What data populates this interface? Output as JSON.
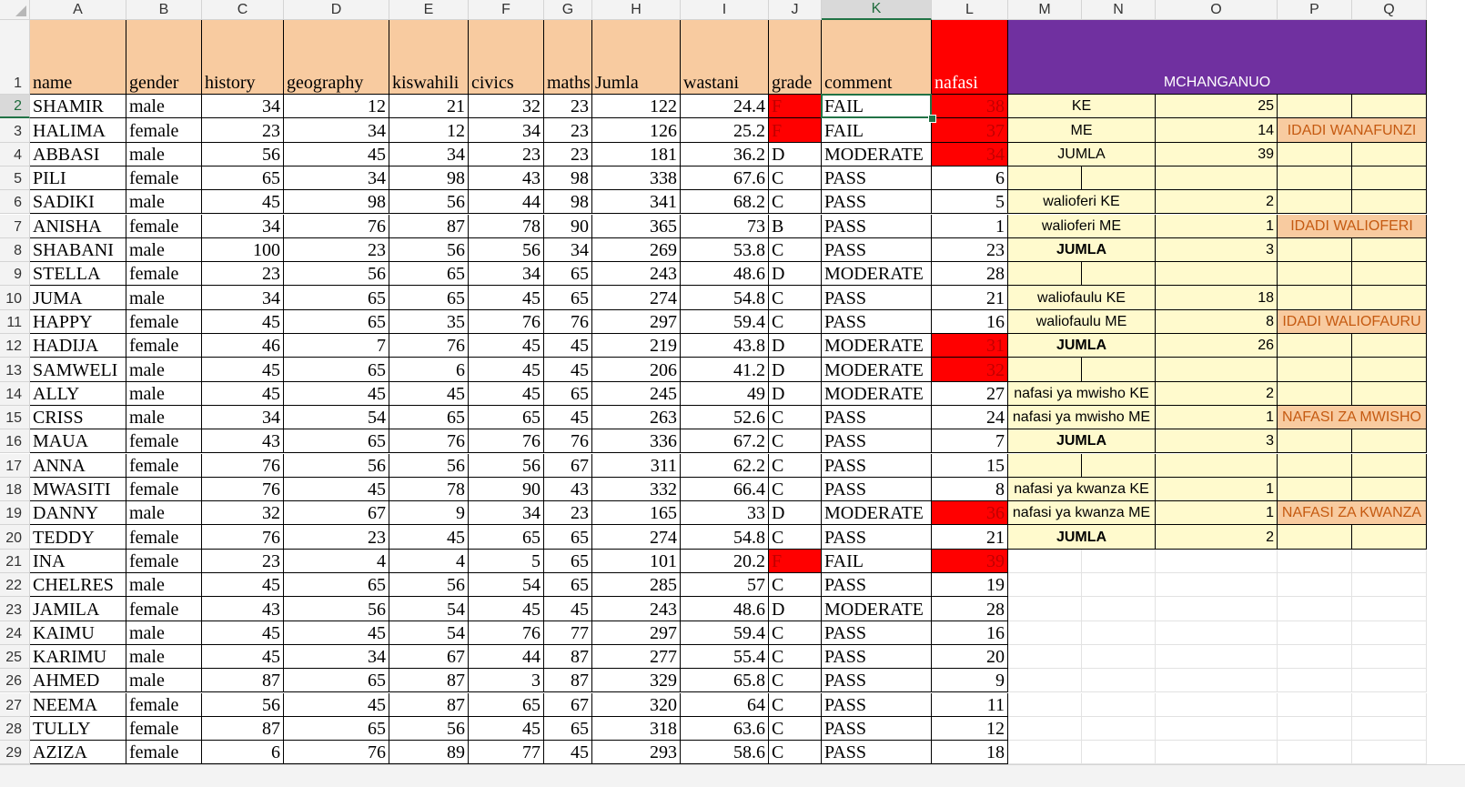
{
  "columns": [
    "A",
    "B",
    "C",
    "D",
    "E",
    "F",
    "G",
    "H",
    "I",
    "J",
    "K",
    "L",
    "M",
    "N",
    "O",
    "P",
    "Q"
  ],
  "selected_column": "K",
  "selected_row": 2,
  "headers": {
    "A": "name",
    "B": "gender",
    "C": "history",
    "D": "geography",
    "E": "kiswahili",
    "F": "civics",
    "G": "maths",
    "H": "Jumla",
    "I": "wastani",
    "J": "grade",
    "K": "comment",
    "L": "nafasi",
    "M": "MCHANGANUO"
  },
  "rows": [
    {
      "n": 2,
      "name": "SHAMIR",
      "gender": "male",
      "history": "34",
      "geography": "12",
      "kiswahili": "21",
      "civics": "32",
      "maths": "23",
      "jumla": "122",
      "wastani": "24.4",
      "grade": "F",
      "comment": "FAIL",
      "nafasi": "38"
    },
    {
      "n": 3,
      "name": "HALIMA",
      "gender": "female",
      "history": "23",
      "geography": "34",
      "kiswahili": "12",
      "civics": "34",
      "maths": "23",
      "jumla": "126",
      "wastani": "25.2",
      "grade": "F",
      "comment": "FAIL",
      "nafasi": "37"
    },
    {
      "n": 4,
      "name": "ABBASI",
      "gender": "male",
      "history": "56",
      "geography": "45",
      "kiswahili": "34",
      "civics": "23",
      "maths": "23",
      "jumla": "181",
      "wastani": "36.2",
      "grade": "D",
      "comment": "MODERATE",
      "nafasi": "34"
    },
    {
      "n": 5,
      "name": "PILI",
      "gender": "female",
      "history": "65",
      "geography": "34",
      "kiswahili": "98",
      "civics": "43",
      "maths": "98",
      "jumla": "338",
      "wastani": "67.6",
      "grade": "C",
      "comment": "PASS",
      "nafasi": "6"
    },
    {
      "n": 6,
      "name": "SADIKI",
      "gender": "male",
      "history": "45",
      "geography": "98",
      "kiswahili": "56",
      "civics": "44",
      "maths": "98",
      "jumla": "341",
      "wastani": "68.2",
      "grade": "C",
      "comment": "PASS",
      "nafasi": "5"
    },
    {
      "n": 7,
      "name": "ANISHA",
      "gender": "female",
      "history": "34",
      "geography": "76",
      "kiswahili": "87",
      "civics": "78",
      "maths": "90",
      "jumla": "365",
      "wastani": "73",
      "grade": "B",
      "comment": "PASS",
      "nafasi": "1"
    },
    {
      "n": 8,
      "name": "SHABANI",
      "gender": "male",
      "history": "100",
      "geography": "23",
      "kiswahili": "56",
      "civics": "56",
      "maths": "34",
      "jumla": "269",
      "wastani": "53.8",
      "grade": "C",
      "comment": "PASS",
      "nafasi": "23"
    },
    {
      "n": 9,
      "name": "STELLA",
      "gender": "female",
      "history": "23",
      "geography": "56",
      "kiswahili": "65",
      "civics": "34",
      "maths": "65",
      "jumla": "243",
      "wastani": "48.6",
      "grade": "D",
      "comment": "MODERATE",
      "nafasi": "28"
    },
    {
      "n": 10,
      "name": "JUMA",
      "gender": "male",
      "history": "34",
      "geography": "65",
      "kiswahili": "65",
      "civics": "45",
      "maths": "65",
      "jumla": "274",
      "wastani": "54.8",
      "grade": "C",
      "comment": "PASS",
      "nafasi": "21"
    },
    {
      "n": 11,
      "name": "HAPPY",
      "gender": "female",
      "history": "45",
      "geography": "65",
      "kiswahili": "35",
      "civics": "76",
      "maths": "76",
      "jumla": "297",
      "wastani": "59.4",
      "grade": "C",
      "comment": "PASS",
      "nafasi": "16"
    },
    {
      "n": 12,
      "name": "HADIJA",
      "gender": "female",
      "history": "46",
      "geography": "7",
      "kiswahili": "76",
      "civics": "45",
      "maths": "45",
      "jumla": "219",
      "wastani": "43.8",
      "grade": "D",
      "comment": "MODERATE",
      "nafasi": "31"
    },
    {
      "n": 13,
      "name": "SAMWELI",
      "gender": "male",
      "history": "45",
      "geography": "65",
      "kiswahili": "6",
      "civics": "45",
      "maths": "45",
      "jumla": "206",
      "wastani": "41.2",
      "grade": "D",
      "comment": "MODERATE",
      "nafasi": "32"
    },
    {
      "n": 14,
      "name": "ALLY",
      "gender": "male",
      "history": "45",
      "geography": "45",
      "kiswahili": "45",
      "civics": "45",
      "maths": "65",
      "jumla": "245",
      "wastani": "49",
      "grade": "D",
      "comment": "MODERATE",
      "nafasi": "27"
    },
    {
      "n": 15,
      "name": "CRISS",
      "gender": "male",
      "history": "34",
      "geography": "54",
      "kiswahili": "65",
      "civics": "65",
      "maths": "45",
      "jumla": "263",
      "wastani": "52.6",
      "grade": "C",
      "comment": "PASS",
      "nafasi": "24"
    },
    {
      "n": 16,
      "name": "MAUA",
      "gender": "female",
      "history": "43",
      "geography": "65",
      "kiswahili": "76",
      "civics": "76",
      "maths": "76",
      "jumla": "336",
      "wastani": "67.2",
      "grade": "C",
      "comment": "PASS",
      "nafasi": "7"
    },
    {
      "n": 17,
      "name": "ANNA",
      "gender": "female",
      "history": "76",
      "geography": "56",
      "kiswahili": "56",
      "civics": "56",
      "maths": "67",
      "jumla": "311",
      "wastani": "62.2",
      "grade": "C",
      "comment": "PASS",
      "nafasi": "15"
    },
    {
      "n": 18,
      "name": "MWASITI",
      "gender": "female",
      "history": "76",
      "geography": "45",
      "kiswahili": "78",
      "civics": "90",
      "maths": "43",
      "jumla": "332",
      "wastani": "66.4",
      "grade": "C",
      "comment": "PASS",
      "nafasi": "8"
    },
    {
      "n": 19,
      "name": "DANNY",
      "gender": "male",
      "history": "32",
      "geography": "67",
      "kiswahili": "9",
      "civics": "34",
      "maths": "23",
      "jumla": "165",
      "wastani": "33",
      "grade": "D",
      "comment": "MODERATE",
      "nafasi": "36"
    },
    {
      "n": 20,
      "name": "TEDDY",
      "gender": "female",
      "history": "76",
      "geography": "23",
      "kiswahili": "45",
      "civics": "65",
      "maths": "65",
      "jumla": "274",
      "wastani": "54.8",
      "grade": "C",
      "comment": "PASS",
      "nafasi": "21"
    },
    {
      "n": 21,
      "name": "INA",
      "gender": "female",
      "history": "23",
      "geography": "4",
      "kiswahili": "4",
      "civics": "5",
      "maths": "65",
      "jumla": "101",
      "wastani": "20.2",
      "grade": "F",
      "comment": "FAIL",
      "nafasi": "39"
    },
    {
      "n": 22,
      "name": "CHELRES",
      "gender": "male",
      "history": "45",
      "geography": "65",
      "kiswahili": "56",
      "civics": "54",
      "maths": "65",
      "jumla": "285",
      "wastani": "57",
      "grade": "C",
      "comment": "PASS",
      "nafasi": "19"
    },
    {
      "n": 23,
      "name": "JAMILA",
      "gender": "female",
      "history": "43",
      "geography": "56",
      "kiswahili": "54",
      "civics": "45",
      "maths": "45",
      "jumla": "243",
      "wastani": "48.6",
      "grade": "D",
      "comment": "MODERATE",
      "nafasi": "28"
    },
    {
      "n": 24,
      "name": "KAIMU",
      "gender": "male",
      "history": "45",
      "geography": "45",
      "kiswahili": "54",
      "civics": "76",
      "maths": "77",
      "jumla": "297",
      "wastani": "59.4",
      "grade": "C",
      "comment": "PASS",
      "nafasi": "16"
    },
    {
      "n": 25,
      "name": "KARIMU",
      "gender": "male",
      "history": "45",
      "geography": "34",
      "kiswahili": "67",
      "civics": "44",
      "maths": "87",
      "jumla": "277",
      "wastani": "55.4",
      "grade": "C",
      "comment": "PASS",
      "nafasi": "20"
    },
    {
      "n": 26,
      "name": "AHMED",
      "gender": "male",
      "history": "87",
      "geography": "65",
      "kiswahili": "87",
      "civics": "3",
      "maths": "87",
      "jumla": "329",
      "wastani": "65.8",
      "grade": "C",
      "comment": "PASS",
      "nafasi": "9"
    },
    {
      "n": 27,
      "name": "NEEMA",
      "gender": "female",
      "history": "56",
      "geography": "45",
      "kiswahili": "87",
      "civics": "65",
      "maths": "67",
      "jumla": "320",
      "wastani": "64",
      "grade": "C",
      "comment": "PASS",
      "nafasi": "11"
    },
    {
      "n": 28,
      "name": "TULLY",
      "gender": "female",
      "history": "87",
      "geography": "65",
      "kiswahili": "56",
      "civics": "45",
      "maths": "65",
      "jumla": "318",
      "wastani": "63.6",
      "grade": "C",
      "comment": "PASS",
      "nafasi": "12"
    },
    {
      "n": 29,
      "name": "AZIZA",
      "gender": "female",
      "history": "6",
      "geography": "76",
      "kiswahili": "89",
      "civics": "77",
      "maths": "45",
      "jumla": "293",
      "wastani": "58.6",
      "grade": "C",
      "comment": "PASS",
      "nafasi": "18"
    }
  ],
  "summary": [
    {
      "row": 2,
      "label": "KE",
      "value": "25",
      "tag": "",
      "bold": false
    },
    {
      "row": 3,
      "label": "ME",
      "value": "14",
      "tag": "IDADI WANAFUNZI",
      "bold": false
    },
    {
      "row": 4,
      "label": "JUMLA",
      "value": "39",
      "tag": "",
      "bold": false
    },
    {
      "row": 5,
      "label": "",
      "value": "",
      "tag": "",
      "bold": false
    },
    {
      "row": 6,
      "label": "walioferi KE",
      "value": "2",
      "tag": "",
      "bold": false
    },
    {
      "row": 7,
      "label": "walioferi ME",
      "value": "1",
      "tag": "IDADI WALIOFERI",
      "bold": false
    },
    {
      "row": 8,
      "label": "JUMLA",
      "value": "3",
      "tag": "",
      "bold": true
    },
    {
      "row": 9,
      "label": "",
      "value": "",
      "tag": "",
      "bold": false
    },
    {
      "row": 10,
      "label": "waliofaulu KE",
      "value": "18",
      "tag": "",
      "bold": false
    },
    {
      "row": 11,
      "label": "waliofaulu ME",
      "value": "8",
      "tag": "IDADI WALIOFAURU",
      "bold": false
    },
    {
      "row": 12,
      "label": "JUMLA",
      "value": "26",
      "tag": "",
      "bold": true
    },
    {
      "row": 13,
      "label": "",
      "value": "",
      "tag": "",
      "bold": false
    },
    {
      "row": 14,
      "label": "nafasi ya mwisho KE",
      "value": "2",
      "tag": "",
      "bold": false
    },
    {
      "row": 15,
      "label": "nafasi ya mwisho ME",
      "value": "1",
      "tag": "NAFASI ZA MWISHO",
      "bold": false
    },
    {
      "row": 16,
      "label": "JUMLA",
      "value": "3",
      "tag": "",
      "bold": true
    },
    {
      "row": 17,
      "label": "",
      "value": "",
      "tag": "",
      "bold": false
    },
    {
      "row": 18,
      "label": "nafasi ya kwanza KE",
      "value": "1",
      "tag": "",
      "bold": false
    },
    {
      "row": 19,
      "label": "nafasi ya kwanza ME",
      "value": "1",
      "tag": "NAFASI ZA KWANZA",
      "bold": false
    },
    {
      "row": 20,
      "label": "JUMLA",
      "value": "2",
      "tag": "",
      "bold": true
    }
  ],
  "colors": {
    "header_fill": "#f8cba0",
    "red": "#ff0000",
    "purple": "#7030a0",
    "yellow": "#fffacd",
    "excel_green": "#217346"
  }
}
